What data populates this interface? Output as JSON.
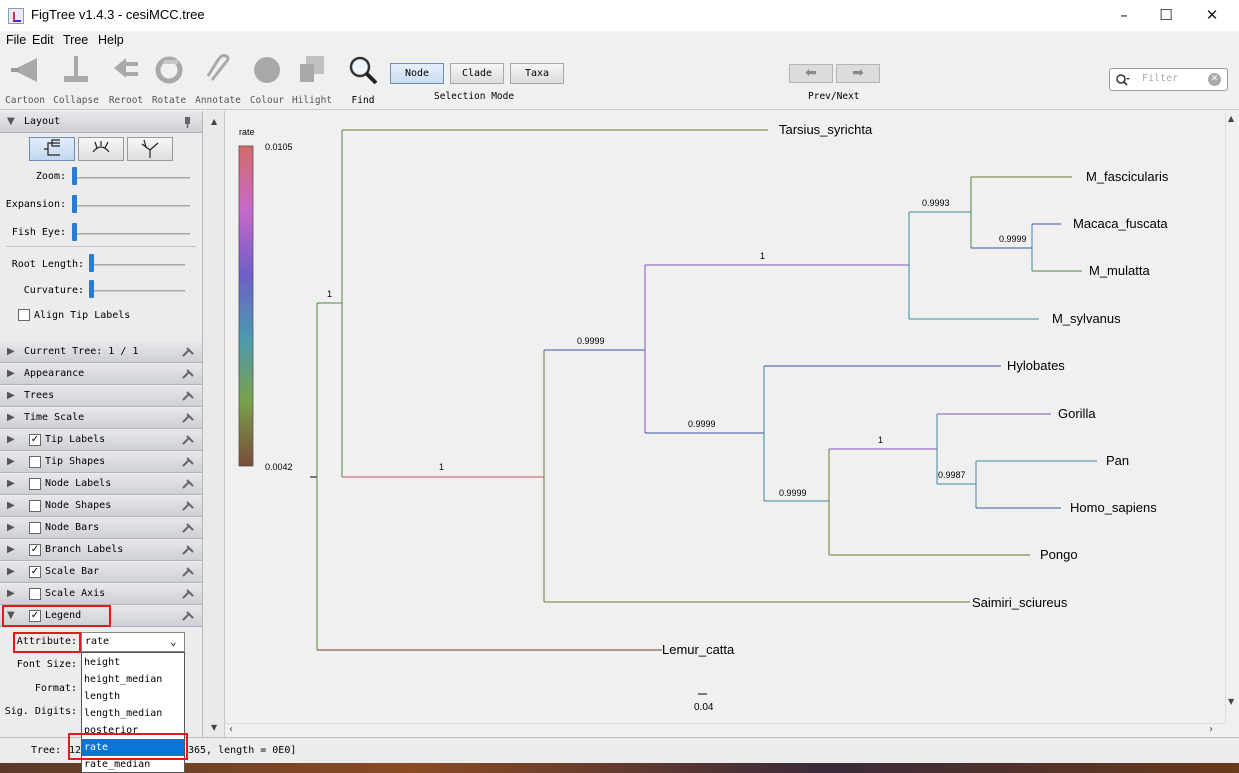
{
  "window": {
    "title": "FigTree v1.4.3 - cesiMCC.tree"
  },
  "menu": [
    "File",
    "Edit",
    "Tree",
    "Help"
  ],
  "toolbar": {
    "tools": [
      "Cartoon",
      "Collapse",
      "Reroot",
      "Rotate",
      "Annotate",
      "Colour",
      "Hilight",
      "Find"
    ],
    "selection_modes": [
      "Node",
      "Clade",
      "Taxa"
    ],
    "selection_caption": "Selection Mode",
    "prevnext_caption": "Prev/Next",
    "filter_placeholder": "Filter"
  },
  "sidebar": {
    "layout_title": "Layout",
    "sliders": [
      "Zoom:",
      "Expansion:",
      "Fish Eye:",
      "Root Length:",
      "Curvature:"
    ],
    "align_tip_labels": "Align Tip Labels",
    "panels": [
      {
        "label": "Current Tree: 1 / 1"
      },
      {
        "label": "Appearance"
      },
      {
        "label": "Trees"
      },
      {
        "label": "Time Scale"
      },
      {
        "label": "Tip Labels",
        "checked": true
      },
      {
        "label": "Tip Shapes",
        "checked": false
      },
      {
        "label": "Node Labels",
        "checked": false
      },
      {
        "label": "Node Shapes",
        "checked": false
      },
      {
        "label": "Node Bars",
        "checked": false
      },
      {
        "label": "Branch Labels",
        "checked": true
      },
      {
        "label": "Scale Bar",
        "checked": true
      },
      {
        "label": "Scale Axis",
        "checked": false
      },
      {
        "label": "Legend",
        "checked": true
      }
    ],
    "legend": {
      "attribute_label": "Attribute:",
      "attribute_value": "rate",
      "font_size_label": "Font Size:",
      "format_label": "Format:",
      "sig_digits_label": "Sig. Digits:",
      "options": [
        "height",
        "height_median",
        "length",
        "length_median",
        "posterior",
        "rate",
        "rate_median"
      ],
      "selected_option": "rate"
    }
  },
  "status": {
    "prefix": "Tree:",
    "fragment1": "12",
    "fragment2": "365, length = 0E0]"
  },
  "tree": {
    "legend": {
      "title": "rate",
      "max": "0.0105",
      "min": "0.0042"
    },
    "colors": {
      "red": "#c0555b",
      "green": "#4c8a3e",
      "olive": "#6b7a35",
      "purple": "#8a4fc0",
      "blue": "#3c4fa0",
      "teal": "#3a8aa0",
      "navy": "#3a5a95",
      "brown": "#7a3a30"
    },
    "tips": [
      "Tarsius_syrichta",
      "M_fascicularis",
      "Macaca_fuscata",
      "M_mulatta",
      "M_sylvanus",
      "Hylobates",
      "Gorilla",
      "Pan",
      "Homo_sapiens",
      "Pongo",
      "Saimiri_sciureus",
      "Lemur_catta"
    ],
    "branch_labels": [
      "1",
      "1",
      "0.9999",
      "0.9999",
      "1",
      "0.9993",
      "0.9999",
      "1",
      "0.9987",
      "0.9999"
    ],
    "scale_bar_value": "0.04"
  }
}
